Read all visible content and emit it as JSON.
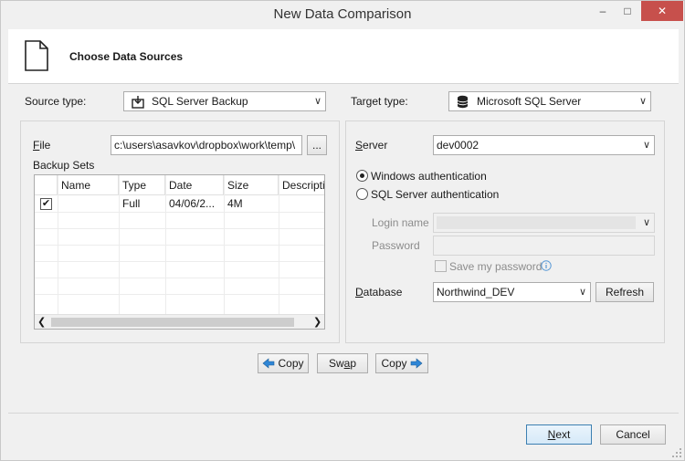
{
  "window": {
    "title": "New Data Comparison",
    "minimize_glyph": "–",
    "maximize_glyph": "□",
    "close_glyph": "✕"
  },
  "header": {
    "title": "Choose Data Sources",
    "icon": "document-icon"
  },
  "source": {
    "type_label": "Source type:",
    "type_value": "SQL Server Backup",
    "file_label": "File",
    "file_value": "c:\\users\\asavkov\\dropbox\\work\\temp\\",
    "browse_label": "...",
    "backup_sets_label": "Backup Sets",
    "columns": [
      "Name",
      "Type",
      "Date",
      "Size",
      "Descriptio"
    ],
    "rows": [
      {
        "checked": true,
        "name": "",
        "type": "Full",
        "date": "04/06/2...",
        "size": "4M",
        "description": ""
      }
    ],
    "check_glyph": "✔"
  },
  "target": {
    "type_label": "Target type:",
    "type_value": "Microsoft SQL Server",
    "server_label": "Server",
    "server_value": "dev0002",
    "auth_windows": "Windows authentication",
    "auth_sql": "SQL Server authentication",
    "login_label": "Login name",
    "login_value": "",
    "password_label": "Password",
    "password_value": "",
    "save_password_label": "Save my password",
    "database_label": "Database",
    "database_value": "Northwind_DEV",
    "refresh_label": "Refresh",
    "selected_auth": "windows"
  },
  "actions": {
    "copy_left_label": "Copy",
    "swap_label": "Swap",
    "copy_right_label": "Copy"
  },
  "footer": {
    "next_label": "Next",
    "cancel_label": "Cancel"
  },
  "colors": {
    "accent": "#3c7fb1",
    "close": "#c7504c",
    "arrow": "#2f86d6"
  }
}
